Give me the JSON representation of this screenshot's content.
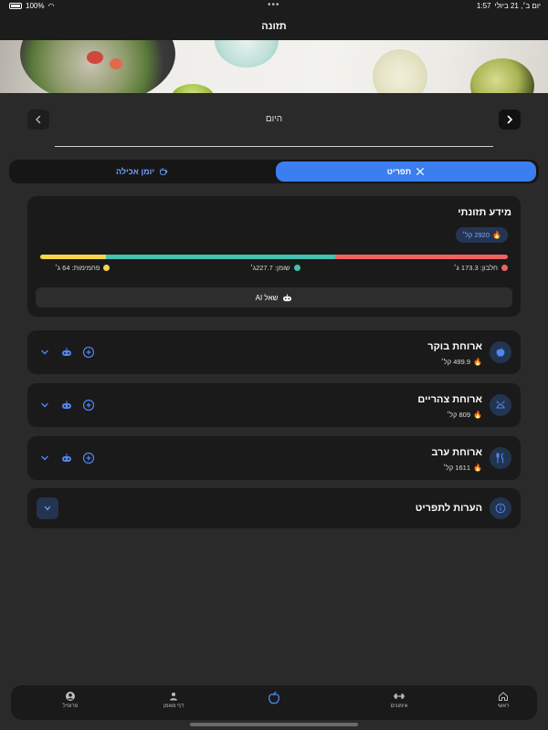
{
  "status": {
    "time": "1:57",
    "date": "יום ב׳, 21 ביולי",
    "battery": "100%"
  },
  "header": {
    "title": "תזונה"
  },
  "day": {
    "label": "היום"
  },
  "segments": {
    "menu": "תפריט",
    "diary": "יומן אכילה"
  },
  "nutrition": {
    "title": "מידע תזונתי",
    "calories": "2920 קל׳",
    "protein": "חלבון: 173.3 ג׳",
    "fat": "שומן: 227.7ג׳",
    "carbs": "פחמימות: 64 ג׳",
    "ask_ai": "שאל AI",
    "colors": {
      "carbs": "#f5d547",
      "fat": "#44c1b1",
      "protein": "#f06262"
    }
  },
  "meals": [
    {
      "title": "ארוחת בוקר",
      "calories": "499.9 קל׳",
      "icon": "apple-icon"
    },
    {
      "title": "ארוחת צהריים",
      "calories": "809 קל׳",
      "icon": "food-tray-icon"
    },
    {
      "title": "ארוחת ערב",
      "calories": "1611 קל׳",
      "icon": "fork-knife-icon"
    }
  ],
  "notes": {
    "title": "הערות לתפריט"
  },
  "tabbar": {
    "home": "ראשי",
    "workouts": "אימונים",
    "nutrition": "",
    "coach": "דף מאמן",
    "profile": "פרופיל"
  },
  "theme": {
    "accent": "#3b7ef0",
    "card": "#1a1a1a",
    "background": "#2a2a2a"
  }
}
